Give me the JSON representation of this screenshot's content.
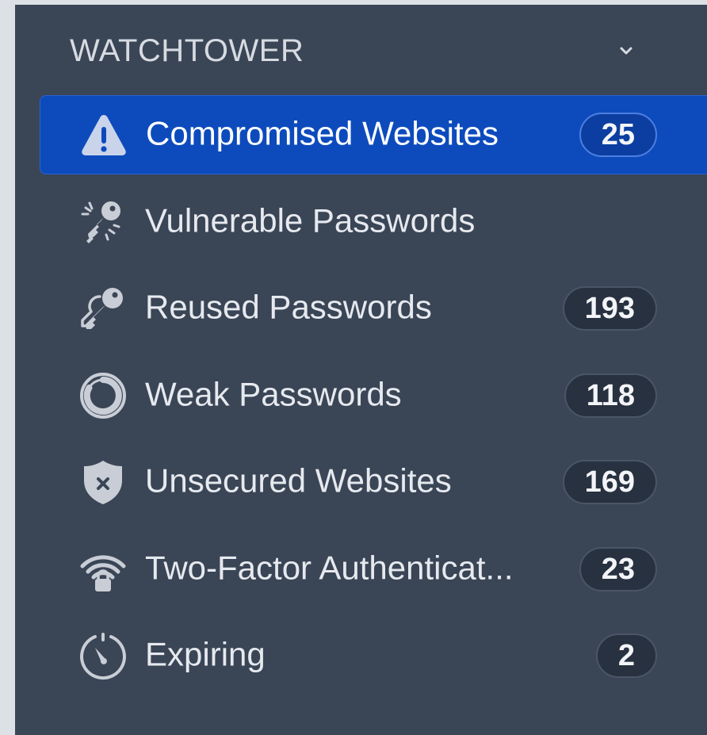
{
  "section": {
    "title": "WATCHTOWER",
    "chevron_icon": "chevron-down-icon"
  },
  "items": [
    {
      "id": "compromised-websites",
      "label": "Compromised Websites",
      "count": "25",
      "icon": "warning-triangle-icon",
      "selected": true
    },
    {
      "id": "vulnerable-passwords",
      "label": "Vulnerable Passwords",
      "count": "",
      "icon": "broken-key-icon",
      "selected": false
    },
    {
      "id": "reused-passwords",
      "label": "Reused Passwords",
      "count": "193",
      "icon": "keys-icon",
      "selected": false
    },
    {
      "id": "weak-passwords",
      "label": "Weak Passwords",
      "count": "118",
      "icon": "circle-ring-icon",
      "selected": false
    },
    {
      "id": "unsecured-websites",
      "label": "Unsecured Websites",
      "count": "169",
      "icon": "shield-x-icon",
      "selected": false
    },
    {
      "id": "two-factor-authentication",
      "label": "Two-Factor Authenticat...",
      "count": "23",
      "icon": "wifi-lock-icon",
      "selected": false
    },
    {
      "id": "expiring",
      "label": "Expiring",
      "count": "2",
      "icon": "timer-icon",
      "selected": false
    }
  ],
  "colors": {
    "sidebar_bg": "#3a4556",
    "selected_bg": "#0d4bbd",
    "badge_bg": "#27313f",
    "text": "#e6e9ee",
    "icon": "#c9ced6"
  }
}
